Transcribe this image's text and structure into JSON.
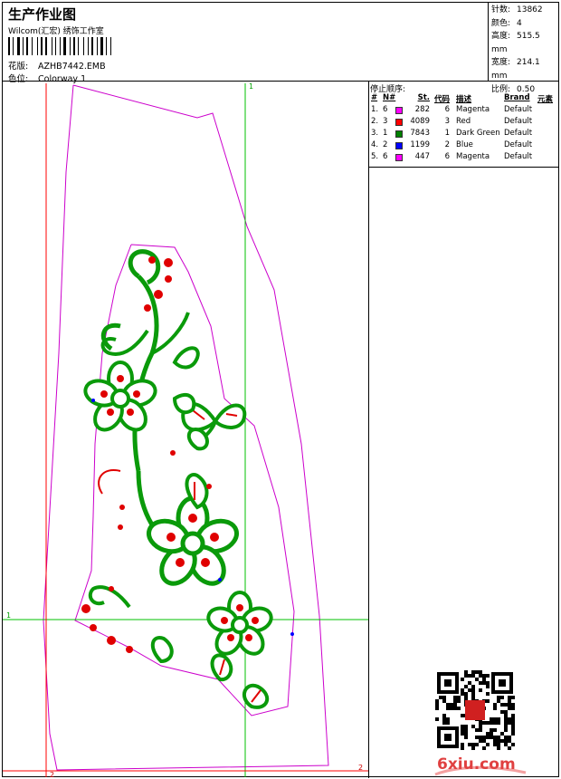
{
  "header": {
    "title": "生产作业图",
    "company": "Wilcom(汇宏) 绣饰工作室",
    "design_label": "花版:",
    "design_name": "AZHB7442.EMB",
    "colorway_label": "色位:",
    "colorway_name": "Colorway 1"
  },
  "specs": [
    {
      "label": "针数:",
      "value": "13862"
    },
    {
      "label": "颜色:",
      "value": "4"
    },
    {
      "label": "高度:",
      "value": "515.5 mm"
    },
    {
      "label": "宽度:",
      "value": "214.1 mm"
    },
    {
      "label": "比例:",
      "value": "0.50"
    }
  ],
  "stop_sequence": {
    "title": "停止顺序:",
    "headers": {
      "idx": "#",
      "needle": "N#",
      "stitches": "St.",
      "code": "代码",
      "desc": "描述",
      "brand": "Brand",
      "element": "元素"
    },
    "rows": [
      {
        "idx": "1.",
        "needle": "6",
        "color": "#ff00ff",
        "stitches": "282",
        "code": "6",
        "desc": "Magenta",
        "brand": "Default"
      },
      {
        "idx": "2.",
        "needle": "3",
        "color": "#ff0000",
        "stitches": "4089",
        "code": "3",
        "desc": "Red",
        "brand": "Default"
      },
      {
        "idx": "3.",
        "needle": "1",
        "color": "#008000",
        "stitches": "7843",
        "code": "1",
        "desc": "Dark Green",
        "brand": "Default"
      },
      {
        "idx": "4.",
        "needle": "2",
        "color": "#0000ff",
        "stitches": "1199",
        "code": "2",
        "desc": "Blue",
        "brand": "Default"
      },
      {
        "idx": "5.",
        "needle": "6",
        "color": "#ff00ff",
        "stitches": "447",
        "code": "6",
        "desc": "Magenta",
        "brand": "Default"
      }
    ]
  },
  "guides": {
    "top": "1",
    "left": "1",
    "bottom": "2",
    "right": "2"
  },
  "watermark": {
    "text": "6xiu.com"
  },
  "colors": {
    "guide_green": "#00c000",
    "guide_red": "#ff0000",
    "outline": "#cc00cc"
  }
}
